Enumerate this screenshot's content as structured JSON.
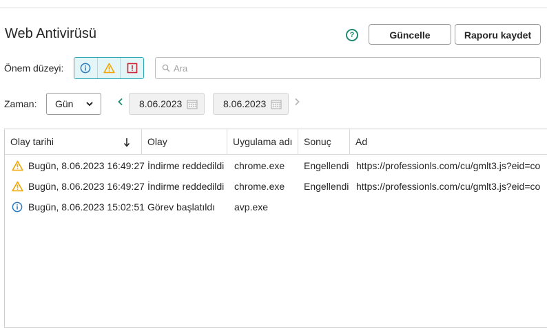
{
  "page": {
    "title": "Web Antivirüsü"
  },
  "toolbar": {
    "help_icon": "question-circle-icon",
    "update_label": "Güncelle",
    "save_report_label": "Raporu kaydet"
  },
  "severity": {
    "label": "Önem düzeyi:",
    "options": [
      {
        "name": "info",
        "icon": "info-icon"
      },
      {
        "name": "warning",
        "icon": "warning-icon"
      },
      {
        "name": "critical",
        "icon": "critical-icon"
      }
    ]
  },
  "search": {
    "placeholder": "Ara"
  },
  "time": {
    "label": "Zaman:",
    "period": "Gün",
    "date_from": "8.06.2023",
    "date_to": "8.06.2023"
  },
  "table": {
    "columns": [
      "Olay tarihi",
      "Olay",
      "Uygulama adı",
      "Sonuç",
      "Ad"
    ],
    "sort_column": "Olay tarihi",
    "sort_direction": "descending",
    "rows": [
      {
        "icon": "warning-icon",
        "date": "Bugün, 8.06.2023 16:49:27",
        "event": "İndirme reddedildi",
        "app": "chrome.exe",
        "result": "Engellendi",
        "name": "https://professionls.com/cu/gmlt3.js?eid=co"
      },
      {
        "icon": "warning-icon",
        "date": "Bugün, 8.06.2023 16:49:27",
        "event": "İndirme reddedildi",
        "app": "chrome.exe",
        "result": "Engellendi",
        "name": "https://professionls.com/cu/gmlt3.js?eid=co"
      },
      {
        "icon": "info-icon",
        "date": "Bugün, 8.06.2023 15:02:51",
        "event": "Görev başlatıldı",
        "app": "avp.exe",
        "result": "",
        "name": ""
      }
    ]
  },
  "colors": {
    "accent": "#1f8a70",
    "filter_border": "#2aa9b5",
    "warning": "#f0a500",
    "critical": "#d0262f",
    "info": "#2b7bbf"
  }
}
